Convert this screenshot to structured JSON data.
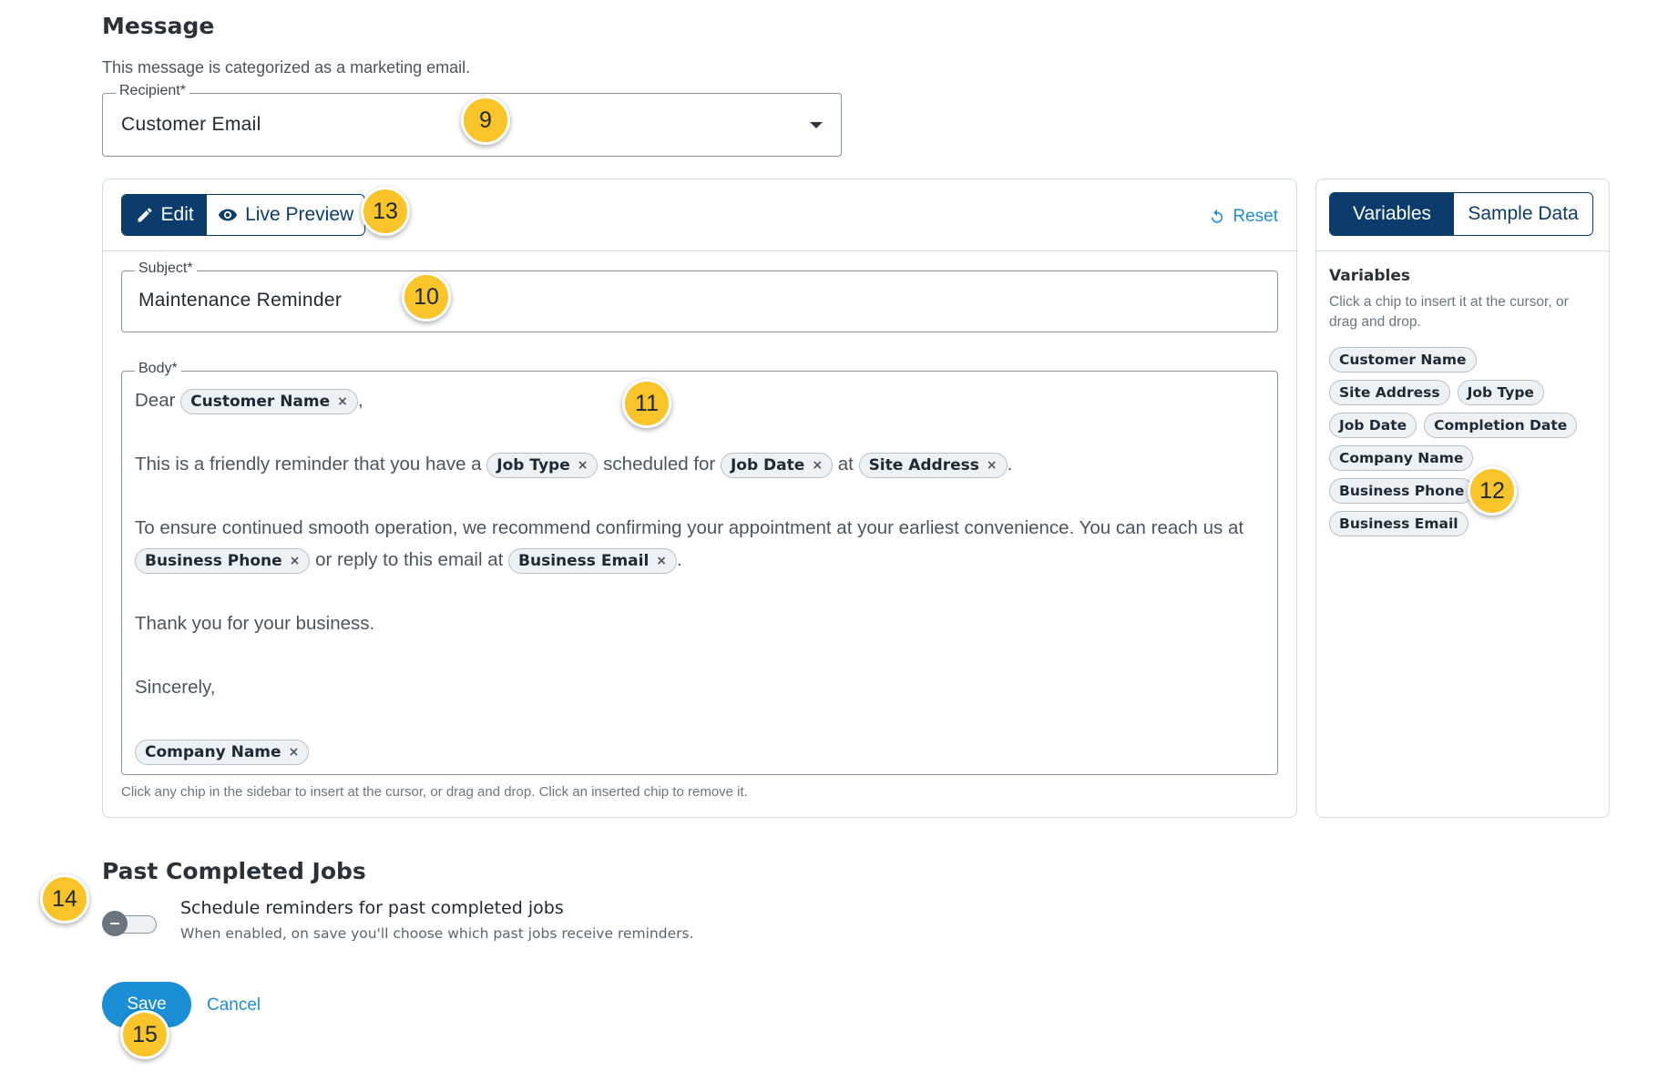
{
  "message": {
    "title": "Message",
    "subtitle": "This message is categorized as a marketing email."
  },
  "recipient": {
    "label": "Recipient*",
    "value": "Customer Email"
  },
  "editor": {
    "tab_edit": "Edit",
    "tab_preview": "Live Preview",
    "active_tab": "Edit",
    "reset_label": "Reset",
    "subject_label": "Subject*",
    "subject_value": "Maintenance Reminder",
    "body_label": "Body*",
    "body": {
      "p1_before": "Dear",
      "p1_chip": "Customer Name",
      "p1_after": ",",
      "p2_before": "This is a friendly reminder that you have a",
      "p2_chip1": "Job Type",
      "p2_mid1": "scheduled for",
      "p2_chip2": "Job Date",
      "p2_mid2": "at",
      "p2_chip3": "Site Address",
      "p2_after": ".",
      "p3_before": "To ensure continued smooth operation, we recommend confirming your appointment at your earliest convenience. You can reach us at",
      "p3_chip1": "Business Phone",
      "p3_mid": "or reply to this email at",
      "p3_chip2": "Business Email",
      "p3_after": ".",
      "p4": "Thank you for your business.",
      "p5": "Sincerely,",
      "p6_chip": "Company Name"
    },
    "chip_remove_glyph": "×",
    "helper": "Click any chip in the sidebar to insert at the cursor, or drag and drop. Click an inserted chip to remove it."
  },
  "sidebar": {
    "tab_variables": "Variables",
    "tab_sample": "Sample Data",
    "active_tab": "Variables",
    "title": "Variables",
    "description": "Click a chip to insert it at the cursor, or drag and drop.",
    "chips": [
      "Customer Name",
      "Site Address",
      "Job Type",
      "Job Date",
      "Completion Date",
      "Company Name",
      "Business Phone",
      "Business Email"
    ]
  },
  "past_jobs": {
    "title": "Past Completed Jobs",
    "toggle_label": "Schedule reminders for past completed jobs",
    "toggle_help": "When enabled, on save you'll choose which past jobs receive reminders.",
    "toggle_on": false
  },
  "actions": {
    "save": "Save",
    "cancel": "Cancel"
  },
  "markers": [
    "9",
    "13",
    "10",
    "11",
    "12",
    "14",
    "15"
  ],
  "colors": {
    "primary_dark": "#0b3c6b",
    "accent_blue": "#1a8fd6",
    "marker_yellow": "#f8c42a"
  }
}
